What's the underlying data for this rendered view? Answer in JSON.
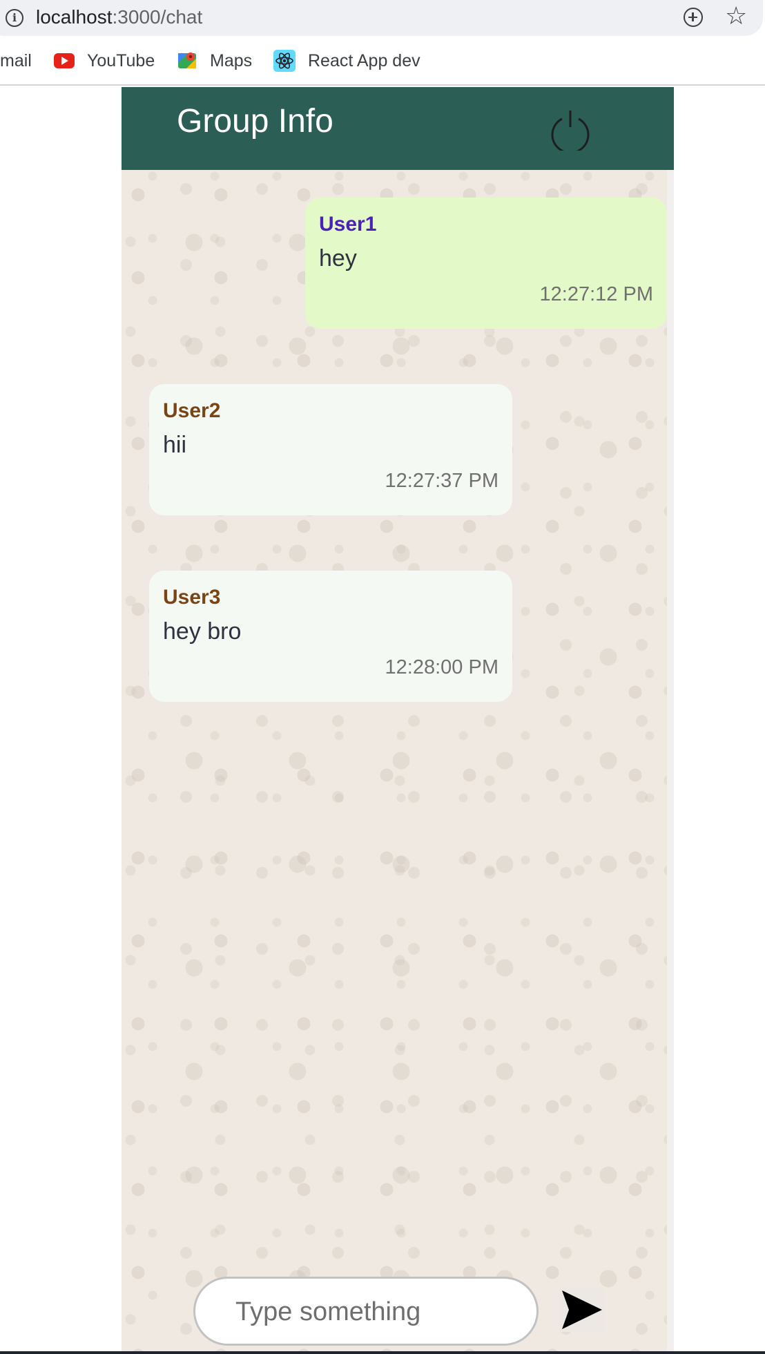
{
  "browser": {
    "url_host": "localhost",
    "url_path": ":3000/chat",
    "bookmarks": [
      {
        "label": "mail"
      },
      {
        "label": "YouTube",
        "icon": "youtube-icon"
      },
      {
        "label": "Maps",
        "icon": "maps-icon"
      },
      {
        "label": "React App dev",
        "icon": "react-icon"
      }
    ]
  },
  "header": {
    "title": "Group Info",
    "logout_icon": "power-icon"
  },
  "messages": [
    {
      "user": "User1",
      "text": "hey",
      "time": "12:27:12 PM",
      "side": "sent",
      "user_color": "#4a22b8"
    },
    {
      "user": "User2",
      "text": "hii",
      "time": "12:27:37 PM",
      "side": "received",
      "user_color": "#7a4414"
    },
    {
      "user": "User3",
      "text": "hey bro",
      "time": "12:28:00 PM",
      "side": "received",
      "user_color": "#7a4414"
    }
  ],
  "composer": {
    "placeholder": "Type something",
    "value": "",
    "send_icon": "send-icon"
  },
  "colors": {
    "header_bg": "#2b5f55",
    "sent_bubble": "#e3f9c8",
    "received_bubble": "#f4f9f3"
  }
}
